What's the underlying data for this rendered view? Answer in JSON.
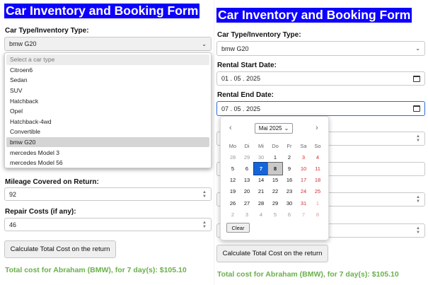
{
  "form_title": "Car Inventory and Booking Form",
  "car_type": {
    "label": "Car Type/Inventory Type:",
    "selected": "bmw G20",
    "options": [
      "Select a car type",
      "Citroen6",
      "Sedan",
      "SUV",
      "Hatchback",
      "Opel",
      "Hatchback-4wd",
      "Convertible",
      "bmw G20",
      "mercedes Model 3",
      "mercedes Model 56"
    ]
  },
  "rental_start": {
    "label": "Rental Start Date:",
    "value": "01 . 05 . 2025"
  },
  "rental_end": {
    "label": "Rental End Date:",
    "value": "07 . 05 . 2025"
  },
  "mileage": {
    "label": "Mileage Covered on Return:",
    "value": "92"
  },
  "repair": {
    "label": "Repair Costs (if any):",
    "value": "46"
  },
  "calc_button": "Calculate Total Cost on the return",
  "result": "Total cost for Abraham (BMW), for 7 day(s): $105.10",
  "calendar": {
    "month": "Mai 2025",
    "prev": "‹",
    "next": "›",
    "weekdays": [
      "Mo",
      "Di",
      "Mi",
      "Do",
      "Fr",
      "Sa",
      "So"
    ],
    "weeks": [
      [
        "28",
        "29",
        "30",
        "1",
        "2",
        "3",
        "4"
      ],
      [
        "5",
        "6",
        "7",
        "8",
        "9",
        "10",
        "11"
      ],
      [
        "12",
        "13",
        "14",
        "15",
        "16",
        "17",
        "18"
      ],
      [
        "19",
        "20",
        "21",
        "22",
        "23",
        "24",
        "25"
      ],
      [
        "26",
        "27",
        "28",
        "29",
        "30",
        "31",
        "1"
      ],
      [
        "2",
        "3",
        "4",
        "5",
        "6",
        "7",
        "8"
      ]
    ],
    "selected_day": "7",
    "today_day": "8",
    "clear": "Clear"
  }
}
